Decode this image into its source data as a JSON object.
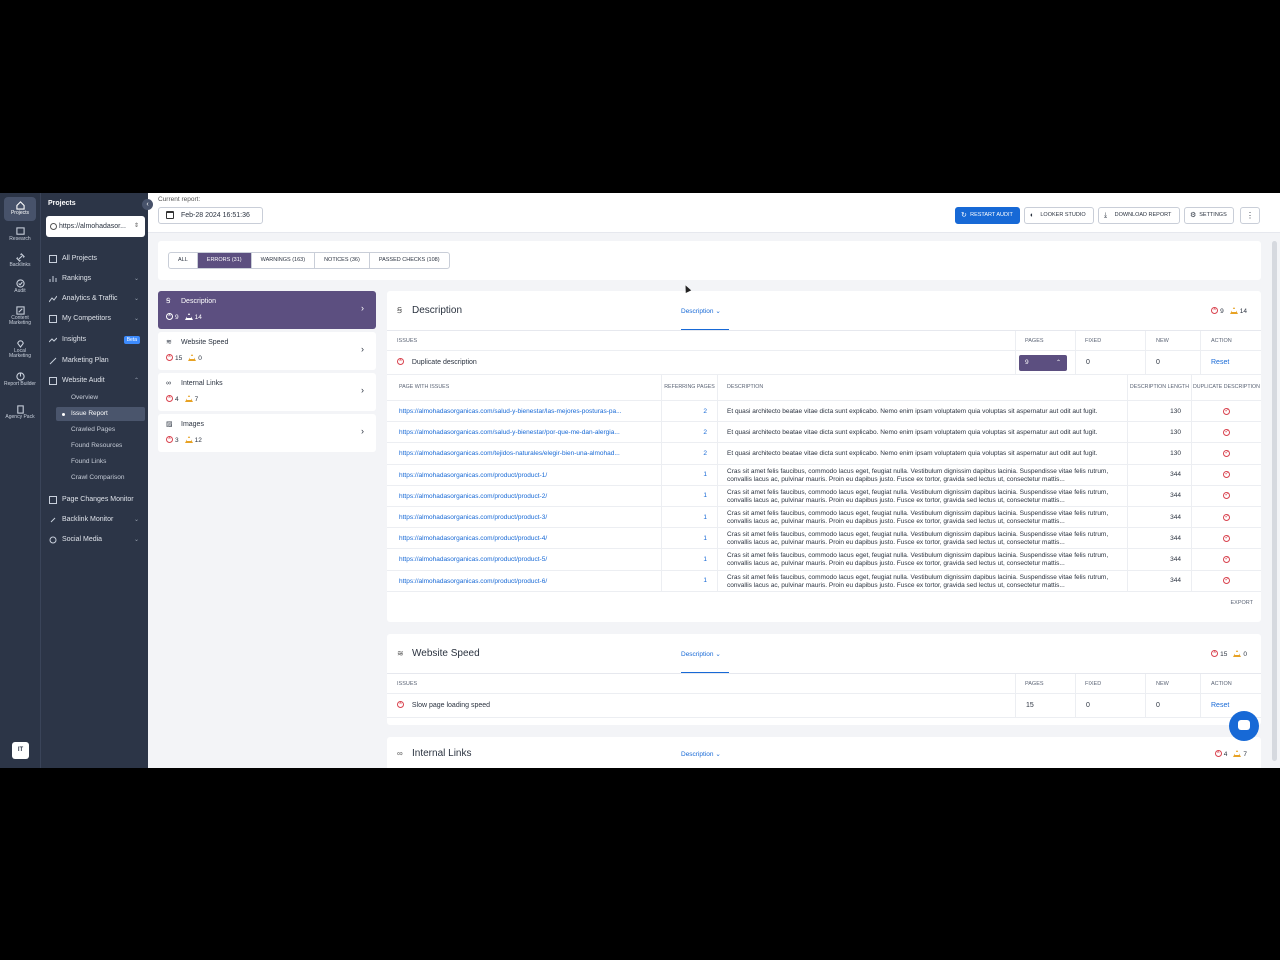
{
  "rail": [
    {
      "label": "Projects",
      "icon": "home-icon",
      "active": true
    },
    {
      "label": "Research",
      "icon": "research-icon"
    },
    {
      "label": "Backlinks",
      "icon": "link-icon"
    },
    {
      "label": "Audit",
      "icon": "audit-icon"
    },
    {
      "label": "Content Marketing",
      "icon": "pen-icon"
    },
    {
      "label": "Local Marketing",
      "icon": "pin-icon"
    },
    {
      "label": "Report Builder",
      "icon": "report-icon"
    },
    {
      "label": "Agency Pack",
      "icon": "building-icon"
    }
  ],
  "avatar": "IT",
  "sidebar": {
    "title": "Projects",
    "project": "https://almohadasor...",
    "nav": [
      {
        "label": "All Projects"
      },
      {
        "label": "Rankings"
      },
      {
        "label": "Analytics & Traffic"
      },
      {
        "label": "My Competitors"
      },
      {
        "label": "Insights",
        "badge": "Beta"
      },
      {
        "label": "Marketing Plan"
      },
      {
        "label": "Website Audit"
      }
    ],
    "sub": [
      "Overview",
      "Issue Report",
      "Crawled Pages",
      "Found Resources",
      "Found Links",
      "Crawl Comparison"
    ],
    "nav2": [
      {
        "label": "Page Changes Monitor"
      },
      {
        "label": "Backlink Monitor"
      },
      {
        "label": "Social Media"
      }
    ]
  },
  "topbar": {
    "current_label": "Current report:",
    "date": "Feb-28 2024 16:51:36",
    "restart": "RESTART AUDIT",
    "looker": "LOOKER STUDIO",
    "download": "DOWNLOAD REPORT",
    "settings": "SETTINGS",
    "more": "⋮"
  },
  "tabs": [
    "ALL",
    "ERRORS (31)",
    "WARNINGS (163)",
    "NOTICES (36)",
    "PASSED CHECKS (108)"
  ],
  "categories": [
    {
      "name": "Description",
      "errors": "9",
      "warnings": "14",
      "icon": "description-icon"
    },
    {
      "name": "Website Speed",
      "errors": "15",
      "warnings": "0",
      "icon": "speed-icon"
    },
    {
      "name": "Internal Links",
      "errors": "4",
      "warnings": "7",
      "icon": "link-icon"
    },
    {
      "name": "Images",
      "errors": "3",
      "warnings": "12",
      "icon": "image-icon"
    }
  ],
  "table_headers": {
    "issues": "ISSUES",
    "pages": "PAGES",
    "fixed": "FIXED",
    "new": "NEW",
    "action": "ACTION"
  },
  "sections": {
    "description": {
      "title": "Description",
      "dropdown": "Description",
      "errors": "9",
      "warnings": "14",
      "issue": {
        "name": "Duplicate description",
        "pages": "9",
        "fixed": "0",
        "new": "0",
        "action": "Reset"
      }
    },
    "speed": {
      "title": "Website Speed",
      "dropdown": "Description",
      "errors": "15",
      "warnings": "0",
      "issue": {
        "name": "Slow page loading speed",
        "pages": "15",
        "fixed": "0",
        "new": "0",
        "action": "Reset"
      }
    },
    "links": {
      "title": "Internal Links",
      "dropdown": "Description",
      "errors": "4",
      "warnings": "7"
    }
  },
  "sub_headers": {
    "page": "PAGE WITH ISSUES",
    "referring": "REFERRING PAGES",
    "description": "DESCRIPTION",
    "length": "DESCRIPTION LENGTH",
    "duplicate": "DUPLICATE DESCRIPTION"
  },
  "sub_rows": [
    {
      "url": "https://almohadasorganicas.com/salud-y-bienestar/las-mejores-posturas-pa...",
      "ref": "2",
      "desc": "Et quasi architecto beatae vitae dicta sunt explicabo. Nemo enim ipsam voluptatem quia voluptas sit aspernatur aut odit aut fugit.",
      "len": "130"
    },
    {
      "url": "https://almohadasorganicas.com/salud-y-bienestar/por-que-me-dan-alergia...",
      "ref": "2",
      "desc": "Et quasi architecto beatae vitae dicta sunt explicabo. Nemo enim ipsam voluptatem quia voluptas sit aspernatur aut odit aut fugit.",
      "len": "130"
    },
    {
      "url": "https://almohadasorganicas.com/tejidos-naturales/elegir-bien-una-almohad...",
      "ref": "2",
      "desc": "Et quasi architecto beatae vitae dicta sunt explicabo. Nemo enim ipsam voluptatem quia voluptas sit aspernatur aut odit aut fugit.",
      "len": "130"
    },
    {
      "url": "https://almohadasorganicas.com/product/product-1/",
      "ref": "1",
      "desc": "Cras sit amet felis faucibus, commodo lacus eget, feugiat nulla. Vestibulum dignissim dapibus lacinia. Suspendisse vitae felis rutrum, convallis lacus ac, pulvinar mauris. Proin eu dapibus justo. Fusce ex tortor, gravida sed lectus ut, consectetur mattis...",
      "len": "344"
    },
    {
      "url": "https://almohadasorganicas.com/product/product-2/",
      "ref": "1",
      "desc": "Cras sit amet felis faucibus, commodo lacus eget, feugiat nulla. Vestibulum dignissim dapibus lacinia. Suspendisse vitae felis rutrum, convallis lacus ac, pulvinar mauris. Proin eu dapibus justo. Fusce ex tortor, gravida sed lectus ut, consectetur mattis...",
      "len": "344"
    },
    {
      "url": "https://almohadasorganicas.com/product/product-3/",
      "ref": "1",
      "desc": "Cras sit amet felis faucibus, commodo lacus eget, feugiat nulla. Vestibulum dignissim dapibus lacinia. Suspendisse vitae felis rutrum, convallis lacus ac, pulvinar mauris. Proin eu dapibus justo. Fusce ex tortor, gravida sed lectus ut, consectetur mattis...",
      "len": "344"
    },
    {
      "url": "https://almohadasorganicas.com/product/product-4/",
      "ref": "1",
      "desc": "Cras sit amet felis faucibus, commodo lacus eget, feugiat nulla. Vestibulum dignissim dapibus lacinia. Suspendisse vitae felis rutrum, convallis lacus ac, pulvinar mauris. Proin eu dapibus justo. Fusce ex tortor, gravida sed lectus ut, consectetur mattis...",
      "len": "344"
    },
    {
      "url": "https://almohadasorganicas.com/product/product-5/",
      "ref": "1",
      "desc": "Cras sit amet felis faucibus, commodo lacus eget, feugiat nulla. Vestibulum dignissim dapibus lacinia. Suspendisse vitae felis rutrum, convallis lacus ac, pulvinar mauris. Proin eu dapibus justo. Fusce ex tortor, gravida sed lectus ut, consectetur mattis...",
      "len": "344"
    },
    {
      "url": "https://almohadasorganicas.com/product/product-6/",
      "ref": "1",
      "desc": "Cras sit amet felis faucibus, commodo lacus eget, feugiat nulla. Vestibulum dignissim dapibus lacinia. Suspendisse vitae felis rutrum, convallis lacus ac, pulvinar mauris. Proin eu dapibus justo. Fusce ex tortor, gravida sed lectus ut, consectetur mattis...",
      "len": "344"
    }
  ],
  "export": "EXPORT",
  "colors": {
    "accent": "#5c4f80",
    "primary": "#1769d6",
    "error": "#d9434f",
    "warning": "#e7a224",
    "sidebar": "#2c3547"
  }
}
